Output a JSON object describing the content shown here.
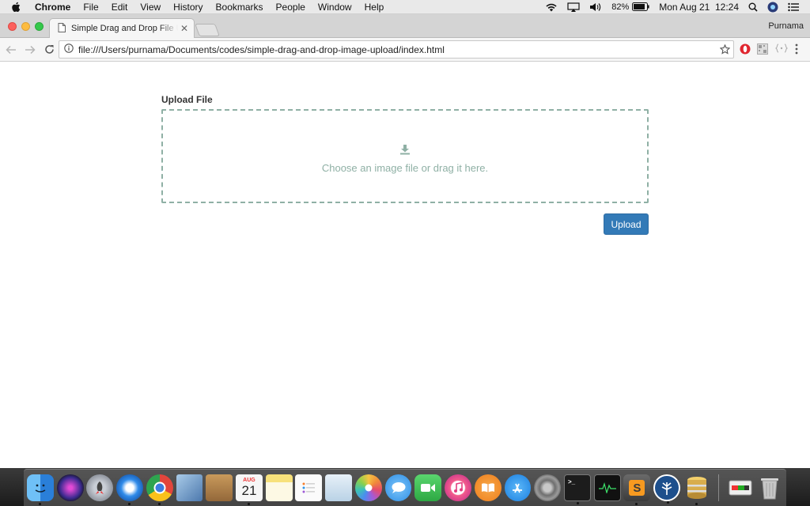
{
  "menubar": {
    "app_name": "Chrome",
    "items": [
      "File",
      "Edit",
      "View",
      "History",
      "Bookmarks",
      "People",
      "Window",
      "Help"
    ],
    "battery": "82%",
    "clock": "Mon Aug 21  12:24"
  },
  "browser": {
    "tab_title": "Simple Drag and Drop File Upload",
    "profile_name": "Purnama",
    "url": "file:///Users/purnama/Documents/codes/simple-drag-and-drop-image-upload/index.html"
  },
  "page": {
    "upload_label": "Upload File",
    "dropzone_hint": "Choose an image file or drag it here.",
    "upload_button": "Upload"
  },
  "dock": {
    "apps": [
      {
        "name": "finder",
        "color": "#3a8ee6",
        "running": true
      },
      {
        "name": "siri",
        "color": "#6d3fd6",
        "running": false
      },
      {
        "name": "launchpad",
        "color": "#8a8f99",
        "running": false
      },
      {
        "name": "safari",
        "color": "#2f8bea",
        "running": true
      },
      {
        "name": "chrome",
        "color": "#e2453c",
        "running": true
      },
      {
        "name": "mail-preview",
        "color": "#5d87b8",
        "running": false
      },
      {
        "name": "contacts",
        "color": "#b7894d",
        "running": false
      },
      {
        "name": "calendar",
        "color": "#f4f4f4",
        "running": true
      },
      {
        "name": "notes",
        "color": "#f6e27a",
        "running": false
      },
      {
        "name": "reminders",
        "color": "#fbfbfb",
        "running": false
      },
      {
        "name": "preview",
        "color": "#d6e6f3",
        "running": false
      },
      {
        "name": "photos",
        "color": "#f0a83c",
        "running": false
      },
      {
        "name": "messages",
        "color": "#4aa8f2",
        "running": false
      },
      {
        "name": "facetime",
        "color": "#3cc35a",
        "running": false
      },
      {
        "name": "itunes",
        "color": "#f35d8c",
        "running": false
      },
      {
        "name": "ibooks",
        "color": "#f08a24",
        "running": false
      },
      {
        "name": "app-store",
        "color": "#2f9df4",
        "running": false
      },
      {
        "name": "system-preferences",
        "color": "#7b7b7b",
        "running": false
      },
      {
        "name": "terminal",
        "color": "#1c1c1c",
        "running": true
      },
      {
        "name": "activity-monitor",
        "color": "#2a2a2a",
        "running": false
      },
      {
        "name": "sublime-text",
        "color": "#5b5b5b",
        "running": true
      },
      {
        "name": "sourcetree",
        "color": "#1d4f8c",
        "running": true
      },
      {
        "name": "sequel-pro",
        "color": "#c9a24a",
        "running": true
      }
    ],
    "calendar_month": "AUG",
    "calendar_day": "21",
    "sublime_letter": "S"
  }
}
